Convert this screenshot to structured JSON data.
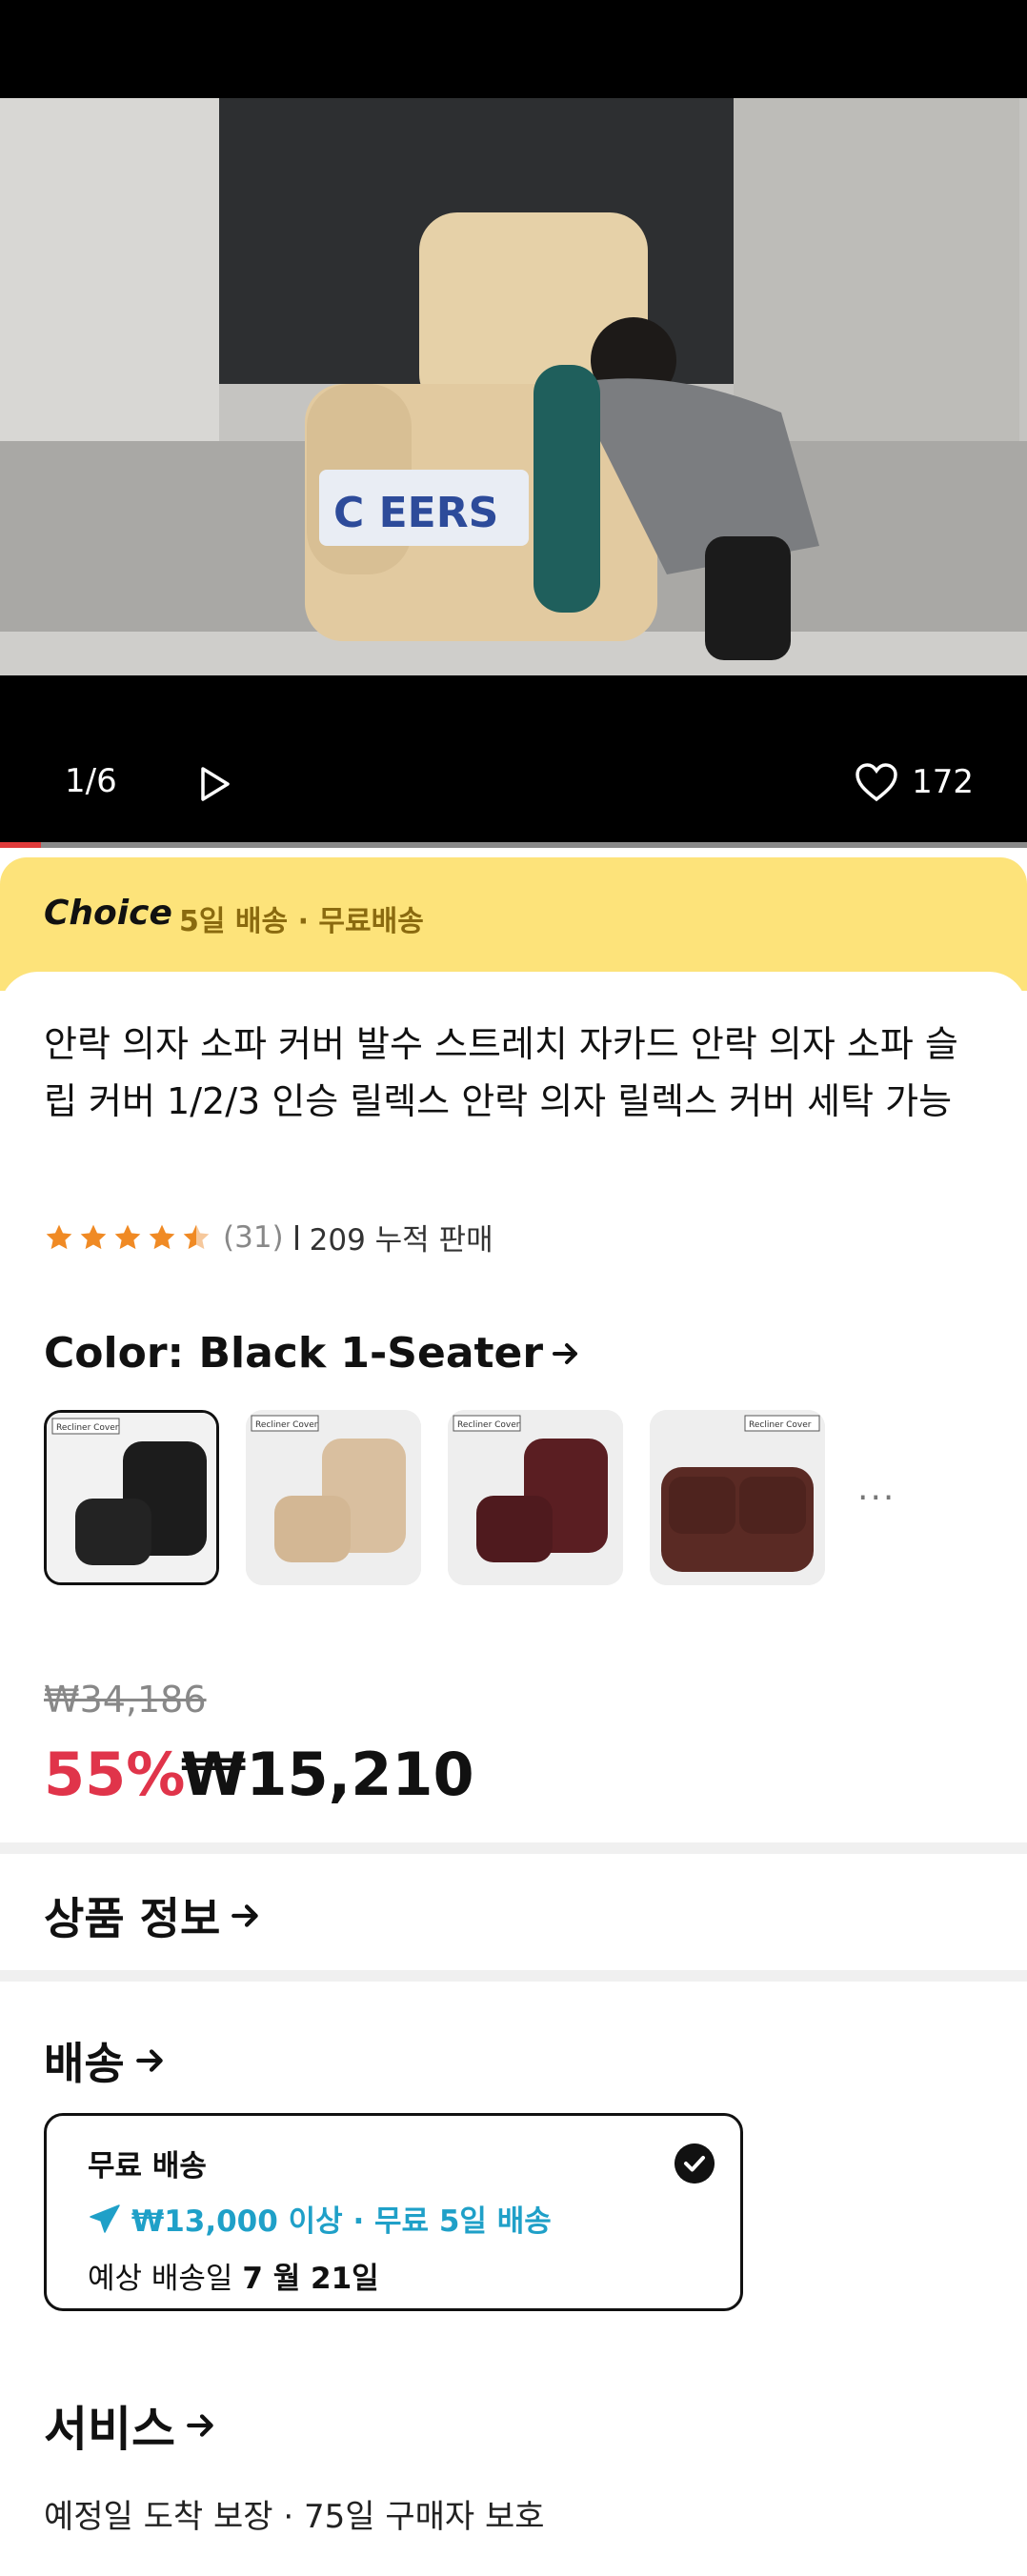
{
  "media": {
    "counter": "1/6",
    "likes": "172",
    "progress": 0.04,
    "brand_watermark": "C EERS"
  },
  "choice": {
    "logo": "Choice",
    "shipping": "5일 배송 · 무료배송"
  },
  "product": {
    "title": "안락 의자 소파 커버 발수 스트레치 자카드 안락 의자 소파 슬립 커버 1/2/3 인승 릴렉스 안락 의자 릴렉스 커버 세탁 가능",
    "rating": 4.5,
    "review_count": "(31)",
    "sold": "209 누적 판매",
    "color_label": "Color: Black 1-Seater",
    "swatch_more": "···",
    "swatches": [
      {
        "label": "Recliner Cover",
        "color": "#1c1c1c"
      },
      {
        "label": "Recliner Cover",
        "color": "#d9bf9f"
      },
      {
        "label": "Recliner Cover",
        "color": "#5a1e22"
      },
      {
        "label": "Recliner Cover",
        "color": "#5a2a24"
      }
    ],
    "original_price": "₩34,186",
    "discount": "55%",
    "price": "₩15,210"
  },
  "sections": {
    "product_info": "상품 정보",
    "shipping": "배송",
    "service": "서비스"
  },
  "shipping_option": {
    "title": "무료 배송",
    "condition": "₩13,000 이상 · 무료 5일 배송",
    "eta_prefix": "예상 배송일",
    "eta_date": "7 월 21일"
  },
  "service": {
    "description": "예정일 도착 보장 · 75일 구매자 보호"
  },
  "colors": {
    "accent_red": "#e0344a",
    "choice_yellow": "#fde37a",
    "shipping_blue": "#1fa0c8"
  }
}
